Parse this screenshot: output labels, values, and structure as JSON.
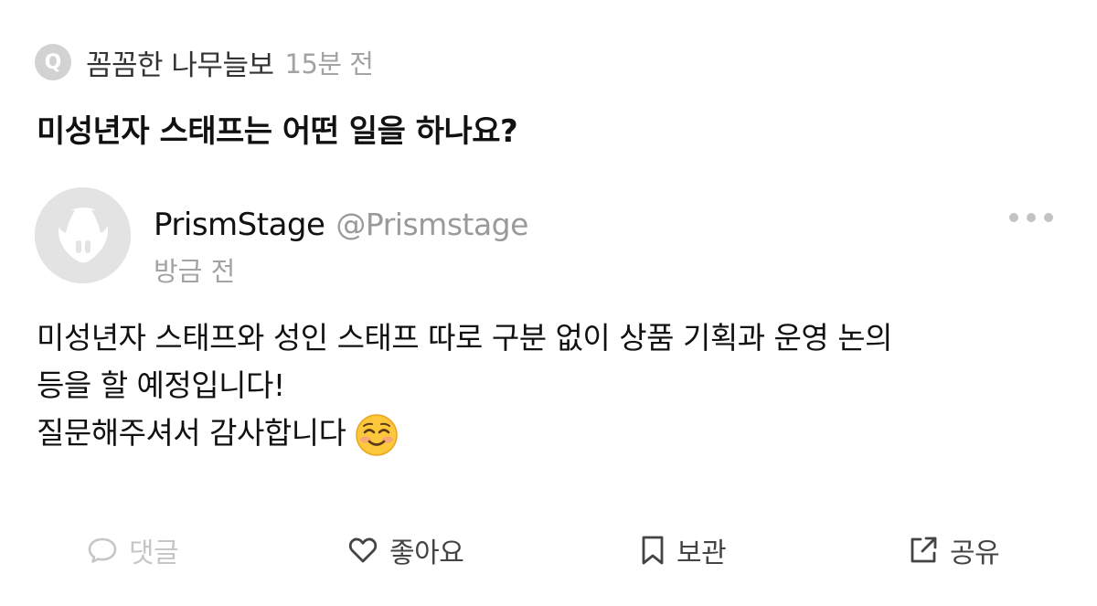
{
  "question": {
    "badge": "Q",
    "author": "꼼꼼한 나무늘보",
    "time": "15분 전",
    "title": "미성년자 스태프는 어떤 일을 하나요?"
  },
  "answer": {
    "author_name": "PrismStage",
    "author_handle": "@Prismstage",
    "time": "방금 전",
    "lines": [
      "미성년자 스태프와 성인 스태프 따로 구분 없이 상품 기획과 운영 논의",
      "등을 할 예정입니다!",
      "질문해주셔서 감사합니다"
    ],
    "emoji": "smiling-face-emoji"
  },
  "actions": {
    "comment": "댓글",
    "like": "좋아요",
    "bookmark": "보관",
    "share": "공유"
  },
  "colors": {
    "muted_text": "#a3a3a3",
    "disabled": "#c6c6c6",
    "icon": "#444444",
    "badge": "#d2d2d2"
  }
}
